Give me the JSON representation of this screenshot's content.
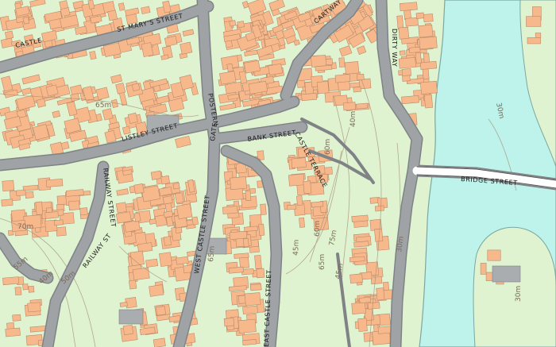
{
  "colors": {
    "land": "#dff3d0",
    "building": "#f7b98c",
    "building_edge": "#b98a69",
    "road": "#9fa3a6",
    "road_edge": "#7f8386",
    "water": "#bdf3ea",
    "water_edge": "#7aa7a2",
    "contour": "#a58f78"
  },
  "street_labels": {
    "st_marys": "ST MARY'S STREET",
    "castle_left": "CASTLE",
    "cartway": "CARTWAY",
    "dirty_way": "DIRTY WAY",
    "listley": "LISTLEY STREET",
    "postern": "POSTERN",
    "gate": "GATE",
    "bank": "BANK STREET",
    "castle_terrace": "CASTLE TERRACE",
    "railway_street": "RAILWAY STREET",
    "railway_st": "RAILWAY ST",
    "west_castle": "WEST CASTLE STREET",
    "east_castle": "EAST CASTLE STREET",
    "bridge": "BRIDGE STREET"
  },
  "contour_labels": {
    "c30a": "30m",
    "c30b": "30m",
    "c30c": "30m",
    "c40a": "40m",
    "c40b": "40m",
    "c45a": "45m",
    "c45b": "45m",
    "c50a": "50m",
    "c55": "55m",
    "c60a": "60m",
    "c60b": "60m",
    "c65a": "65m",
    "c65b": "65m",
    "c65c": "65m",
    "c70": "70m",
    "c75": "75m"
  }
}
